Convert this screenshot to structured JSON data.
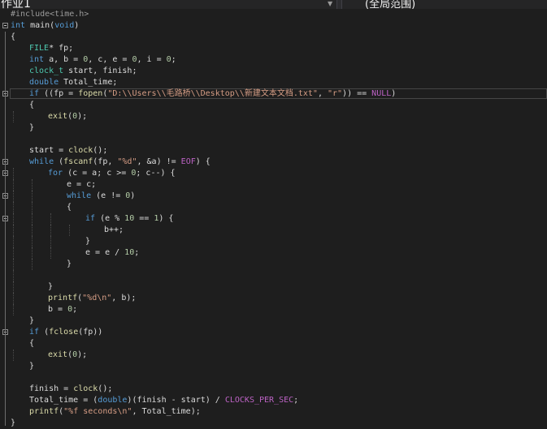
{
  "nav": {
    "project": "作业1",
    "scope": "(全局范围)"
  },
  "editor": {
    "highlight_line": 7,
    "lines": [
      {
        "indent": 0,
        "fold": false,
        "tokens": [
          {
            "t": "#include<time.h>",
            "c": "pp"
          }
        ]
      },
      {
        "indent": 0,
        "fold": true,
        "tokens": [
          {
            "t": "int",
            "c": "kw"
          },
          {
            "t": " main(",
            "c": ""
          },
          {
            "t": "void",
            "c": "kw"
          },
          {
            "t": ")",
            "c": ""
          }
        ]
      },
      {
        "indent": 0,
        "fold": false,
        "tokens": [
          {
            "t": "{",
            "c": ""
          }
        ]
      },
      {
        "indent": 1,
        "fold": false,
        "tokens": [
          {
            "t": "FILE",
            "c": "ty"
          },
          {
            "t": "* fp;",
            "c": ""
          }
        ]
      },
      {
        "indent": 1,
        "fold": false,
        "tokens": [
          {
            "t": "int",
            "c": "kw"
          },
          {
            "t": " a, b = ",
            "c": ""
          },
          {
            "t": "0",
            "c": "num"
          },
          {
            "t": ", c, e = ",
            "c": ""
          },
          {
            "t": "0",
            "c": "num"
          },
          {
            "t": ", i = ",
            "c": ""
          },
          {
            "t": "0",
            "c": "num"
          },
          {
            "t": ";",
            "c": ""
          }
        ]
      },
      {
        "indent": 1,
        "fold": false,
        "tokens": [
          {
            "t": "clock_t",
            "c": "ty"
          },
          {
            "t": " start, finish;",
            "c": ""
          }
        ]
      },
      {
        "indent": 1,
        "fold": false,
        "tokens": [
          {
            "t": "double",
            "c": "kw"
          },
          {
            "t": " Total_time;",
            "c": ""
          }
        ]
      },
      {
        "indent": 1,
        "fold": true,
        "tokens": [
          {
            "t": "if",
            "c": "kw"
          },
          {
            "t": " ((fp = ",
            "c": ""
          },
          {
            "t": "fopen",
            "c": "fn"
          },
          {
            "t": "(",
            "c": ""
          },
          {
            "t": "\"D:\\\\Users\\\\毛路桥\\\\Desktop\\\\新建文本文档.txt\"",
            "c": "str"
          },
          {
            "t": ", ",
            "c": ""
          },
          {
            "t": "\"r\"",
            "c": "str"
          },
          {
            "t": ")) == ",
            "c": ""
          },
          {
            "t": "NULL",
            "c": "mac"
          },
          {
            "t": ")",
            "c": ""
          }
        ]
      },
      {
        "indent": 1,
        "fold": false,
        "tokens": [
          {
            "t": "{",
            "c": ""
          }
        ]
      },
      {
        "indent": 2,
        "fold": false,
        "tokens": [
          {
            "t": "exit",
            "c": "fn"
          },
          {
            "t": "(",
            "c": ""
          },
          {
            "t": "0",
            "c": "num"
          },
          {
            "t": ");",
            "c": ""
          }
        ]
      },
      {
        "indent": 1,
        "fold": false,
        "tokens": [
          {
            "t": "}",
            "c": ""
          }
        ]
      },
      {
        "indent": 0,
        "fold": false,
        "tokens": []
      },
      {
        "indent": 1,
        "fold": false,
        "tokens": [
          {
            "t": "start = ",
            "c": ""
          },
          {
            "t": "clock",
            "c": "fn"
          },
          {
            "t": "();",
            "c": ""
          }
        ]
      },
      {
        "indent": 1,
        "fold": true,
        "tokens": [
          {
            "t": "while",
            "c": "kw"
          },
          {
            "t": " (",
            "c": ""
          },
          {
            "t": "fscanf",
            "c": "fn"
          },
          {
            "t": "(fp, ",
            "c": ""
          },
          {
            "t": "\"%d\"",
            "c": "str"
          },
          {
            "t": ", &a) != ",
            "c": ""
          },
          {
            "t": "EOF",
            "c": "mac"
          },
          {
            "t": ") {",
            "c": ""
          }
        ]
      },
      {
        "indent": 2,
        "fold": true,
        "tokens": [
          {
            "t": "for",
            "c": "kw"
          },
          {
            "t": " (c = a; c >= ",
            "c": ""
          },
          {
            "t": "0",
            "c": "num"
          },
          {
            "t": "; c--) {",
            "c": ""
          }
        ]
      },
      {
        "indent": 3,
        "fold": false,
        "tokens": [
          {
            "t": "e = c;",
            "c": ""
          }
        ]
      },
      {
        "indent": 3,
        "fold": true,
        "tokens": [
          {
            "t": "while",
            "c": "kw"
          },
          {
            "t": " (e != ",
            "c": ""
          },
          {
            "t": "0",
            "c": "num"
          },
          {
            "t": ")",
            "c": ""
          }
        ]
      },
      {
        "indent": 3,
        "fold": false,
        "tokens": [
          {
            "t": "{",
            "c": ""
          }
        ]
      },
      {
        "indent": 4,
        "fold": true,
        "tokens": [
          {
            "t": "if",
            "c": "kw"
          },
          {
            "t": " (e % ",
            "c": ""
          },
          {
            "t": "10",
            "c": "num"
          },
          {
            "t": " == ",
            "c": ""
          },
          {
            "t": "1",
            "c": "num"
          },
          {
            "t": ") {",
            "c": ""
          }
        ]
      },
      {
        "indent": 5,
        "fold": false,
        "tokens": [
          {
            "t": "b++;",
            "c": ""
          }
        ]
      },
      {
        "indent": 4,
        "fold": false,
        "tokens": [
          {
            "t": "}",
            "c": ""
          }
        ]
      },
      {
        "indent": 4,
        "fold": false,
        "tokens": [
          {
            "t": "e = e / ",
            "c": ""
          },
          {
            "t": "10",
            "c": "num"
          },
          {
            "t": ";",
            "c": ""
          }
        ]
      },
      {
        "indent": 3,
        "fold": false,
        "tokens": [
          {
            "t": "}",
            "c": ""
          }
        ]
      },
      {
        "indent": 2,
        "fold": false,
        "tokens": []
      },
      {
        "indent": 2,
        "fold": false,
        "tokens": [
          {
            "t": "}",
            "c": ""
          }
        ]
      },
      {
        "indent": 2,
        "fold": false,
        "tokens": [
          {
            "t": "printf",
            "c": "fn"
          },
          {
            "t": "(",
            "c": ""
          },
          {
            "t": "\"%d\\n\"",
            "c": "str"
          },
          {
            "t": ", b);",
            "c": ""
          }
        ]
      },
      {
        "indent": 2,
        "fold": false,
        "tokens": [
          {
            "t": "b = ",
            "c": ""
          },
          {
            "t": "0",
            "c": "num"
          },
          {
            "t": ";",
            "c": ""
          }
        ]
      },
      {
        "indent": 1,
        "fold": false,
        "tokens": [
          {
            "t": "}",
            "c": ""
          }
        ]
      },
      {
        "indent": 1,
        "fold": true,
        "tokens": [
          {
            "t": "if",
            "c": "kw"
          },
          {
            "t": " (",
            "c": ""
          },
          {
            "t": "fclose",
            "c": "fn"
          },
          {
            "t": "(fp))",
            "c": ""
          }
        ]
      },
      {
        "indent": 1,
        "fold": false,
        "tokens": [
          {
            "t": "{",
            "c": ""
          }
        ]
      },
      {
        "indent": 2,
        "fold": false,
        "tokens": [
          {
            "t": "exit",
            "c": "fn"
          },
          {
            "t": "(",
            "c": ""
          },
          {
            "t": "0",
            "c": "num"
          },
          {
            "t": ");",
            "c": ""
          }
        ]
      },
      {
        "indent": 1,
        "fold": false,
        "tokens": [
          {
            "t": "}",
            "c": ""
          }
        ]
      },
      {
        "indent": 0,
        "fold": false,
        "tokens": []
      },
      {
        "indent": 1,
        "fold": false,
        "tokens": [
          {
            "t": "finish = ",
            "c": ""
          },
          {
            "t": "clock",
            "c": "fn"
          },
          {
            "t": "();",
            "c": ""
          }
        ]
      },
      {
        "indent": 1,
        "fold": false,
        "tokens": [
          {
            "t": "Total_time = (",
            "c": ""
          },
          {
            "t": "double",
            "c": "kw"
          },
          {
            "t": ")(finish - start) / ",
            "c": ""
          },
          {
            "t": "CLOCKS_PER_SEC",
            "c": "mac"
          },
          {
            "t": ";",
            "c": ""
          }
        ]
      },
      {
        "indent": 1,
        "fold": false,
        "tokens": [
          {
            "t": "printf",
            "c": "fn"
          },
          {
            "t": "(",
            "c": ""
          },
          {
            "t": "\"%f seconds\\n\"",
            "c": "str"
          },
          {
            "t": ", Total_time);",
            "c": ""
          }
        ]
      },
      {
        "indent": 0,
        "fold": false,
        "tokens": [
          {
            "t": "}",
            "c": ""
          }
        ]
      }
    ]
  }
}
